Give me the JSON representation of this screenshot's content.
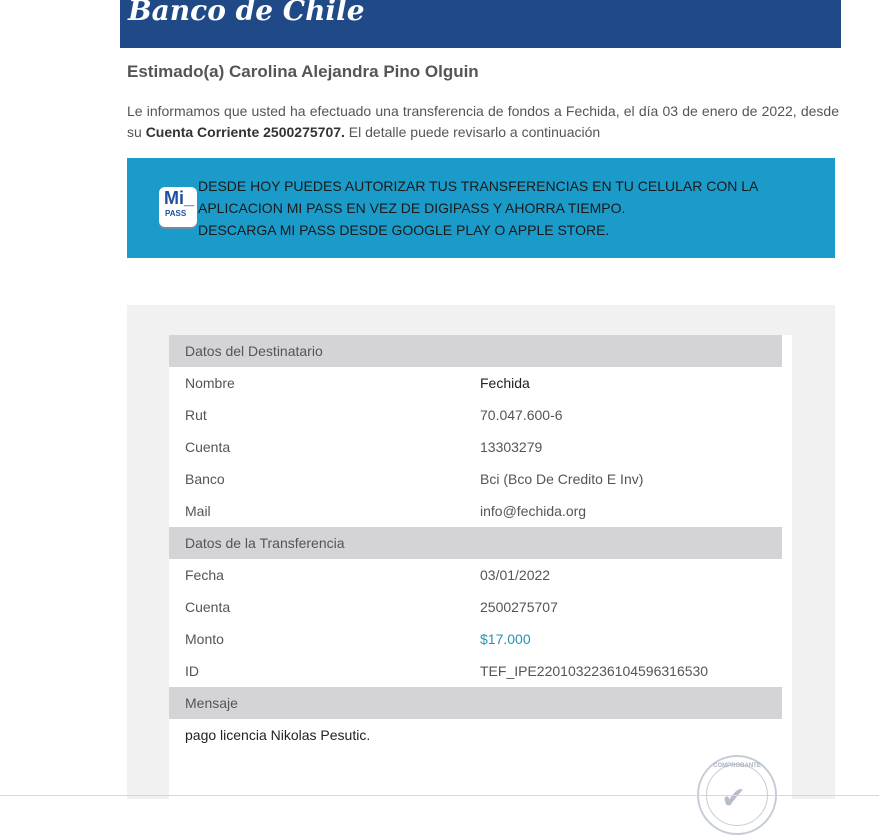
{
  "header": {
    "bank_name": "Banco de Chile"
  },
  "greeting": "Estimado(a) Carolina Alejandra Pino Olguin",
  "intro": {
    "text_1": "Le informamos que usted ha efectuado una transferencia de fondos a Fechida, el día 03 de enero de 2022, desde su ",
    "account_bold": "Cuenta Corriente 2500275707.",
    "text_2": " El detalle puede revisarlo a continuación"
  },
  "banner": {
    "logo_mi": "Mi_",
    "logo_pass": "PASS",
    "line_1": "DESDE HOY PUEDES AUTORIZAR TUS TRANSFERENCIAS EN TU CELULAR CON LA APLICACION MI PASS EN VEZ DE DIGIPASS Y AHORRA TIEMPO.",
    "line_2": "DESCARGA MI PASS DESDE GOOGLE PLAY O APPLE STORE."
  },
  "recipient": {
    "title": "Datos del Destinatario",
    "rows": [
      {
        "label": "Nombre",
        "value": "Fechida"
      },
      {
        "label": "Rut",
        "value": "70.047.600-6"
      },
      {
        "label": "Cuenta",
        "value": "13303279"
      },
      {
        "label": "Banco",
        "value": "Bci (Bco De Credito E Inv)"
      },
      {
        "label": "Mail",
        "value": "info@fechida.org"
      }
    ]
  },
  "transfer": {
    "title": "Datos de la Transferencia",
    "rows": [
      {
        "label": "Fecha",
        "value": "03/01/2022"
      },
      {
        "label": "Cuenta",
        "value": "2500275707"
      },
      {
        "label": "Monto",
        "value": "$17.000"
      },
      {
        "label": "ID",
        "value": "TEF_IPE220103223610459631653​0"
      }
    ]
  },
  "message": {
    "title": "Mensaje",
    "text": "pago licencia Nikolas Pesutic."
  },
  "stamp": {
    "text": "COMPROBANTE"
  },
  "colors": {
    "header_bg": "#204a87",
    "banner_bg": "#1b9bc9",
    "amount": "#2693b6",
    "section_bg": "#d4d4d6"
  }
}
